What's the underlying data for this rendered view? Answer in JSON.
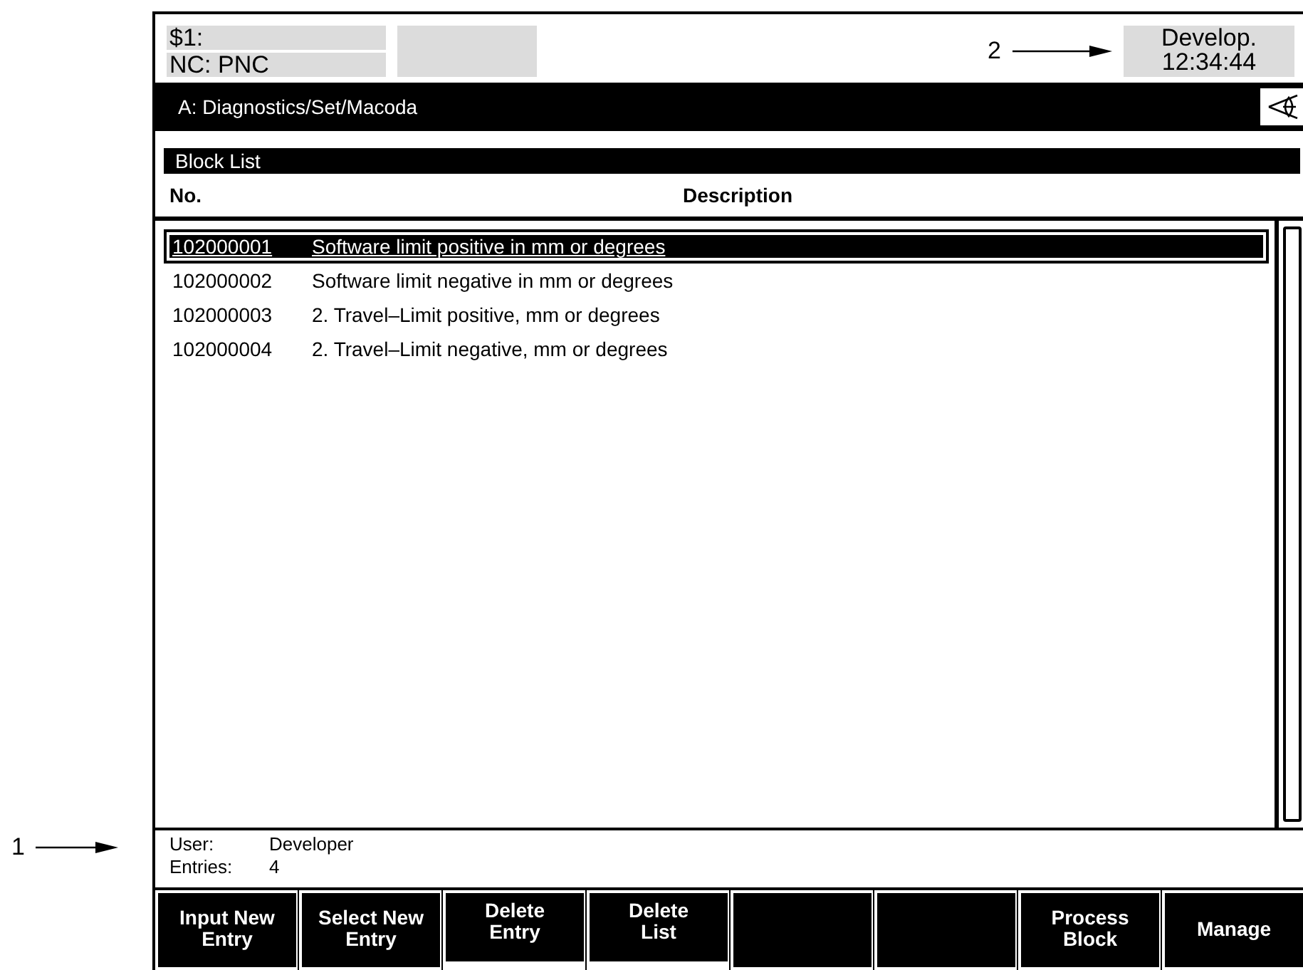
{
  "annotations": [
    {
      "label": "1"
    },
    {
      "label": "2"
    }
  ],
  "header": {
    "channel": "$1:",
    "nc": "NC: PNC",
    "mode": "Develop.",
    "time": "12:34:44"
  },
  "path_bar": {
    "path": "A:  Diagnostics/Set/Macoda"
  },
  "panel": {
    "title": "Block List"
  },
  "table": {
    "columns": [
      "No.",
      "Description"
    ],
    "rows": [
      {
        "number": "102000001",
        "description": "Software limit positive in mm or degrees",
        "selected": true
      },
      {
        "number": "102000002",
        "description": "Software limit negative in mm or degrees",
        "selected": false
      },
      {
        "number": "102000003",
        "description": "2. Travel–Limit positive, mm or degrees",
        "selected": false
      },
      {
        "number": "102000004",
        "description": "2. Travel–Limit negative, mm or degrees",
        "selected": false
      }
    ]
  },
  "info": [
    {
      "label": "User:",
      "value": "Developer"
    },
    {
      "label": "Entries:",
      "value": "4"
    }
  ],
  "softkeys": [
    {
      "label": "Input New Entry",
      "marked": false
    },
    {
      "label": "Select New Entry",
      "marked": false
    },
    {
      "label": "Delete Entry",
      "marked": true
    },
    {
      "label": "Delete List",
      "marked": true
    },
    {
      "marked": false
    },
    {
      "marked": false
    },
    {
      "label": "Process Block",
      "marked": false
    },
    {
      "label": "Manage",
      "marked": false
    }
  ]
}
